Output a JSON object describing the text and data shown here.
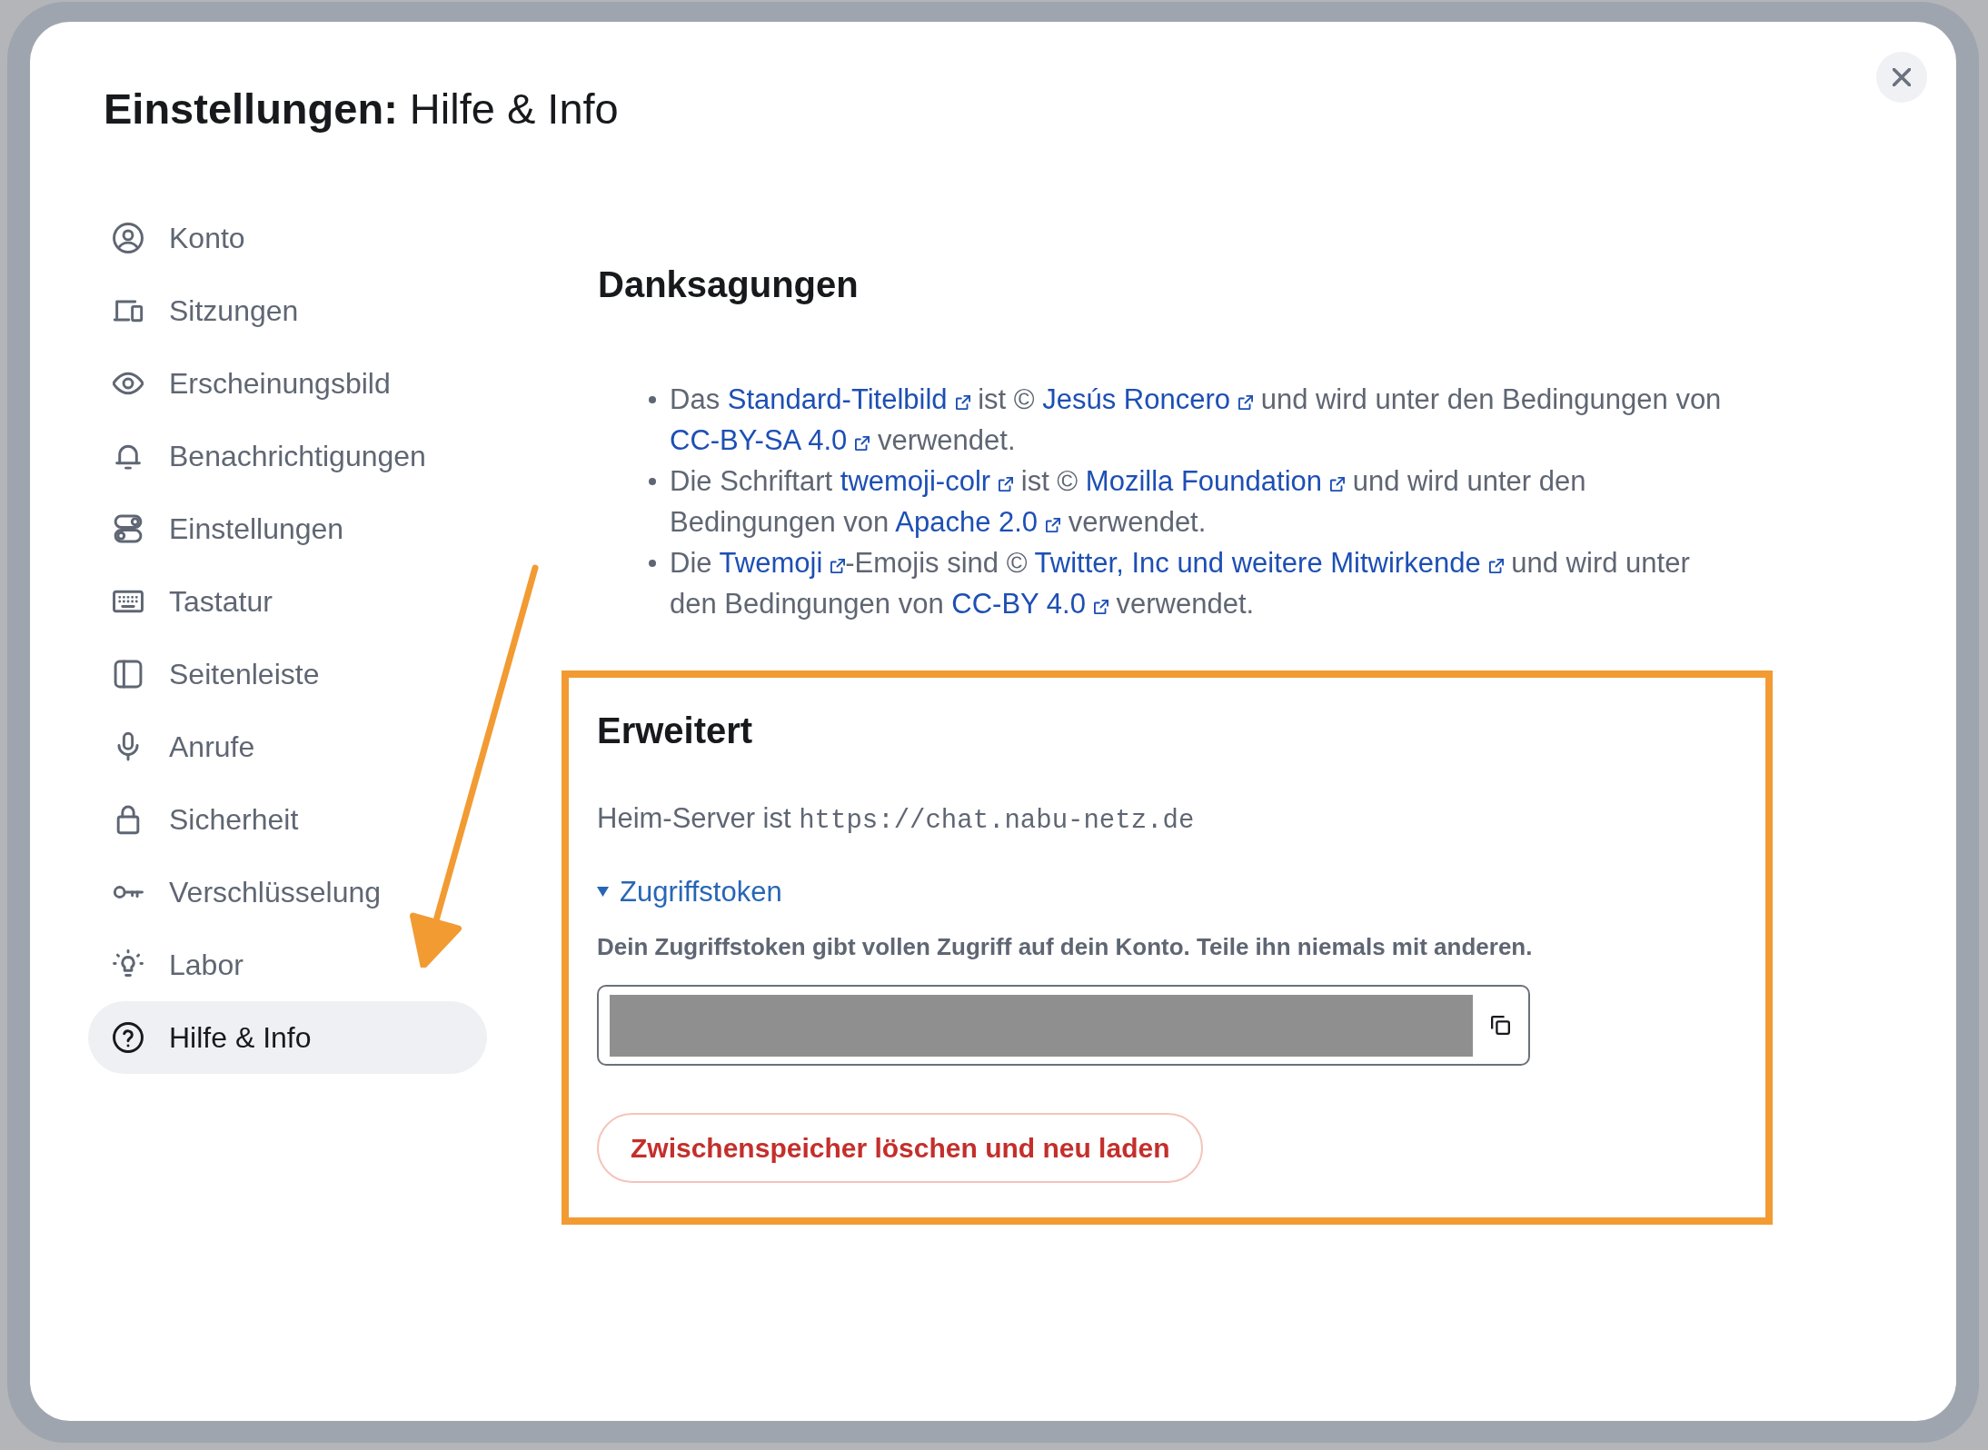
{
  "dialog": {
    "title": "**Einstellungen:** Hilfe & Info"
  },
  "sidebar": {
    "items": [
      {
        "label": "Konto",
        "selected": false
      },
      {
        "label": "Sitzungen",
        "selected": false
      },
      {
        "label": "Erscheinungsbild",
        "selected": false
      },
      {
        "label": "Benachrichtigungen",
        "selected": false
      },
      {
        "label": "Einstellungen",
        "selected": false
      },
      {
        "label": "Tastatur",
        "selected": false
      },
      {
        "label": "Seitenleiste",
        "selected": false
      },
      {
        "label": "Anrufe",
        "selected": false
      },
      {
        "label": "Sicherheit",
        "selected": false
      },
      {
        "label": "Verschlüsselung",
        "selected": false
      },
      {
        "label": "Labor",
        "selected": false
      },
      {
        "label": "Hilfe & Info",
        "selected": true
      }
    ]
  },
  "credits": {
    "heading": "Danksagungen",
    "items": [
      {
        "parts": [
          {
            "kind": "text",
            "text": "Das "
          },
          {
            "kind": "link",
            "text": "Standard-Titelbild"
          },
          {
            "kind": "text",
            "text": " ist © "
          },
          {
            "kind": "link",
            "text": "Jesús Roncero"
          },
          {
            "kind": "text",
            "text": " und wird unter den Bedingungen von "
          },
          {
            "kind": "link",
            "text": "CC-BY-SA 4.0"
          },
          {
            "kind": "text",
            "text": " verwendet."
          }
        ]
      },
      {
        "parts": [
          {
            "kind": "text",
            "text": "Die Schriftart "
          },
          {
            "kind": "link",
            "text": "twemoji-colr"
          },
          {
            "kind": "text",
            "text": " ist © "
          },
          {
            "kind": "link",
            "text": "Mozilla Foundation"
          },
          {
            "kind": "text",
            "text": " und wird unter den Bedingungen von "
          },
          {
            "kind": "link",
            "text": "Apache 2.0"
          },
          {
            "kind": "text",
            "text": " verwendet."
          }
        ]
      },
      {
        "parts": [
          {
            "kind": "text",
            "text": "Die "
          },
          {
            "kind": "link",
            "text": "Twemoji"
          },
          {
            "kind": "text",
            "text": "-Emojis sind © "
          },
          {
            "kind": "link",
            "text": "Twitter, Inc und weitere Mitwirkende"
          },
          {
            "kind": "text",
            "text": " und wird unter den Bedingungen von "
          },
          {
            "kind": "link",
            "text": "CC-BY 4.0"
          },
          {
            "kind": "text",
            "text": " verwendet."
          }
        ]
      }
    ]
  },
  "advanced": {
    "heading": "Erweitert",
    "highlighted": true,
    "homeserver_label": "Heim-Server ist",
    "homeserver_url": "https://chat.nabu-netz.de",
    "token_toggle": {
      "label": "Zugriffstoken",
      "expanded": true
    },
    "token_warning": "Dein Zugriffstoken gibt vollen Zugriff auf dein Konto. Teile ihn niemals mit anderen.",
    "token_redacted": true,
    "clear_cache_button": "Zwischenspeicher löschen und neu laden"
  },
  "pointer_arrow": true
}
